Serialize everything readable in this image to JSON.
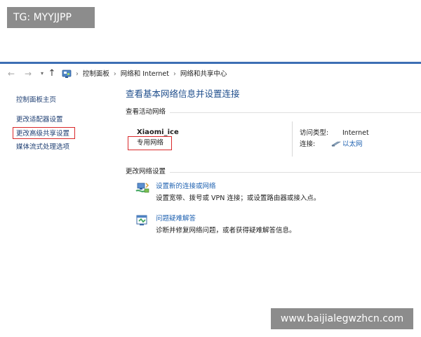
{
  "watermarks": {
    "top_label": "TG: MYYJJPP",
    "bottom_url": "www.baijialegwzhcn.com"
  },
  "nav": {
    "back_icon": "back-arrow-icon",
    "forward_icon": "forward-arrow-icon",
    "up_icon": "up-arrow-icon",
    "breadcrumb": [
      "控制面板",
      "网络和 Internet",
      "网络和共享中心"
    ],
    "separator": "›"
  },
  "sidebar": {
    "items": [
      {
        "label": "控制面板主页"
      },
      {
        "label": "更改适配器设置"
      },
      {
        "label": "更改高级共享设置",
        "highlighted": true
      },
      {
        "label": "媒体流式处理选项"
      }
    ]
  },
  "main": {
    "title": "查看基本网络信息并设置连接",
    "active_networks_label": "查看活动网络",
    "network": {
      "name": "Xiaomi_ice",
      "type": "专用网络",
      "access_type_label": "访问类型:",
      "access_type_value": "Internet",
      "connection_label": "连接:",
      "connection_value": "以太网"
    },
    "change_settings_label": "更改网络设置",
    "tasks": [
      {
        "icon": "new-connection-icon",
        "link": "设置新的连接或网络",
        "desc": "设置宽带、拨号或 VPN 连接；或设置路由器或接入点。"
      },
      {
        "icon": "troubleshoot-icon",
        "link": "问题疑难解答",
        "desc": "诊断并修复网络问题，或者获得疑难解答信息。"
      }
    ]
  },
  "colors": {
    "accent_line": "#3d6fb4",
    "highlight_box": "#d9292b",
    "link": "#1f62b1",
    "title": "#1f4e8c",
    "watermark_bg": "#8c8c8c"
  }
}
